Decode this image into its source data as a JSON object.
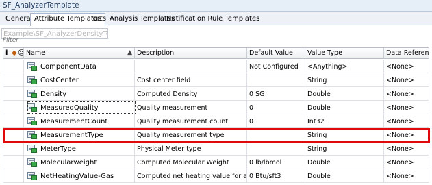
{
  "window": {
    "title": "SF_AnalyzerTemplate"
  },
  "tabs": [
    {
      "label": "General",
      "active": false
    },
    {
      "label": "Attribute Templates",
      "active": true
    },
    {
      "label": "Ports",
      "active": false
    },
    {
      "label": "Analysis Templates",
      "active": false
    },
    {
      "label": "Notification Rule Templates",
      "active": false
    }
  ],
  "template_field": {
    "value": "Example\\SF_AnalyzerDensityTemplate"
  },
  "filter": {
    "placeholder": "Filter"
  },
  "grid": {
    "icon_headers": [
      "i",
      "◆",
      "☺"
    ],
    "columns": [
      "Name",
      "Description",
      "Default Value",
      "Value Type",
      "Data Reference"
    ],
    "sorted_column": "Name",
    "rows": [
      {
        "name": "ComponentData",
        "description": "",
        "default_value": "Not Configured",
        "value_type": "<Anything>",
        "data_reference": "<None>"
      },
      {
        "name": "CostCenter",
        "description": "Cost center field",
        "default_value": "",
        "value_type": "String",
        "data_reference": "<None>"
      },
      {
        "name": "Density",
        "description": "Computed Density",
        "default_value": "0 SG",
        "value_type": "Double",
        "data_reference": "<None>"
      },
      {
        "name": "MeasuredQuality",
        "description": "Quality measurement",
        "default_value": "0",
        "value_type": "Double",
        "data_reference": "<None>",
        "focused": true
      },
      {
        "name": "MeasurementCount",
        "description": "Quality measurement count",
        "default_value": "0",
        "value_type": "Int32",
        "data_reference": "<None>"
      },
      {
        "name": "MeasurementType",
        "description": "Quality measurement type",
        "default_value": "",
        "value_type": "String",
        "data_reference": "<None>",
        "highlighted": true
      },
      {
        "name": "MeterType",
        "description": "Physical Meter type",
        "default_value": "",
        "value_type": "String",
        "data_reference": "<None>"
      },
      {
        "name": "Molecularweight",
        "description": "Computed Molecular Weight",
        "default_value": "0 lb/lbmol",
        "value_type": "Double",
        "data_reference": "<None>"
      },
      {
        "name": "NetHeatingValue-Gas",
        "description": "Computed net heating value for a gas",
        "default_value": "0 Btu/sft3",
        "value_type": "Double",
        "data_reference": "<None>"
      }
    ]
  },
  "colors": {
    "highlight": "#e0090b",
    "attribute_icon": "#3aa64a"
  }
}
